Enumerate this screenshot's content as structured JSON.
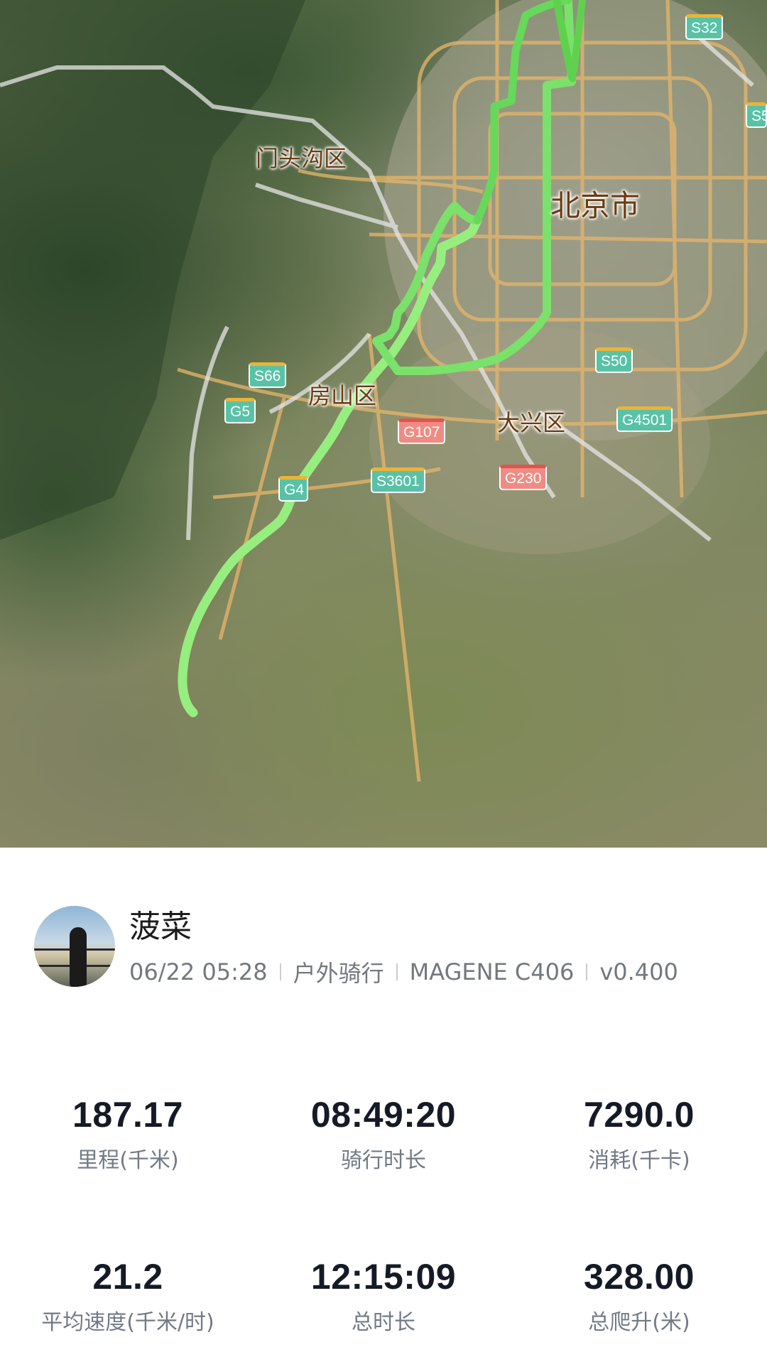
{
  "map": {
    "places": {
      "mentougou": "门头沟区",
      "beijing": "北京市",
      "fangshan": "房山区",
      "daxing": "大兴区"
    },
    "road_badges": {
      "s32": "S32",
      "s5": "S5",
      "s66": "S66",
      "g5": "G5",
      "s50": "S50",
      "g107": "G107",
      "g4501": "G4501",
      "g4": "G4",
      "s3601": "S3601",
      "g230": "G230"
    },
    "route_color": "#8ef27a"
  },
  "profile": {
    "name": "菠菜",
    "datetime": "06/22 05:28",
    "activity_type": "户外骑行",
    "device": "MAGENE C406",
    "version": "v0.400"
  },
  "stats": {
    "distance": {
      "value": "187.17",
      "label": "里程(千米)"
    },
    "ride_time": {
      "value": "08:49:20",
      "label": "骑行时长"
    },
    "calories": {
      "value": "7290.0",
      "label": "消耗(千卡)"
    },
    "avg_speed": {
      "value": "21.2",
      "label": "平均速度(千米/时)"
    },
    "total_time": {
      "value": "12:15:09",
      "label": "总时长"
    },
    "elevation_gain": {
      "value": "328.00",
      "label": "总爬升(米)"
    }
  }
}
